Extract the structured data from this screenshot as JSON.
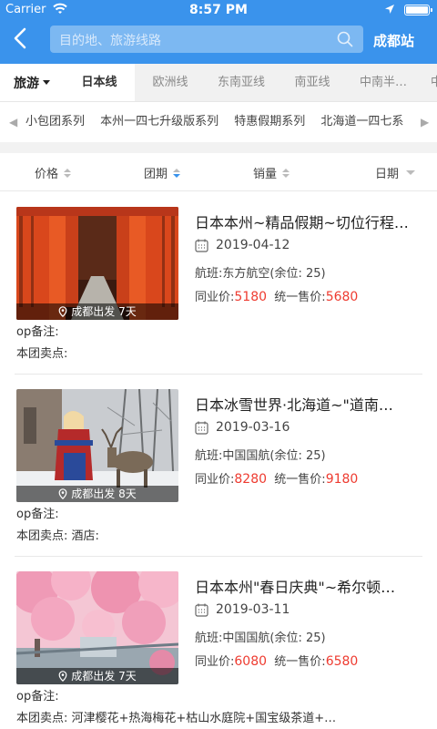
{
  "status_bar": {
    "carrier": "Carrier",
    "time": "8:57 PM"
  },
  "nav": {
    "search_placeholder": "目的地、旅游线路",
    "station": "成都站"
  },
  "tabs": {
    "first": "旅游",
    "items": [
      "日本线",
      "欧洲线",
      "东南亚线",
      "南亚线",
      "中南半…",
      "中东非线"
    ]
  },
  "series": [
    "小包团系列",
    "本州一四七升级版系列",
    "特惠假期系列",
    "北海道一四七系"
  ],
  "sort": {
    "price": "价格",
    "group": "团期",
    "sales": "销量",
    "date": "日期"
  },
  "tours": [
    {
      "title": "日本本州~精品假期~切位行程…",
      "date": "2019-04-12",
      "flight": "航班:东方航空(余位: 25)",
      "peer_label": "同业价:",
      "peer_price": "5180",
      "retail_label": "统一售价:",
      "retail_price": "5680",
      "badge": "成都出发 7天",
      "op_note": "op备注:",
      "selling": "本团卖点:"
    },
    {
      "title": "日本冰雪世界·北海道~\"道南…",
      "date": "2019-03-16",
      "flight": "航班:中国国航(余位: 25)",
      "peer_label": "同业价:",
      "peer_price": "8280",
      "retail_label": "统一售价:",
      "retail_price": "9180",
      "badge": "成都出发 8天",
      "op_note": "op备注:",
      "selling": "本团卖点:   酒店:"
    },
    {
      "title": "日本本州\"春日庆典\"~希尔顿…",
      "date": "2019-03-11",
      "flight": "航班:中国国航(余位: 25)",
      "peer_label": "同业价:",
      "peer_price": "6080",
      "retail_label": "统一售价:",
      "retail_price": "6580",
      "badge": "成都出发 7天",
      "op_note": "op备注:",
      "selling": "本团卖点:  河津樱花+热海梅花+枯山水庭院+国宝级茶道+…"
    }
  ],
  "colors": {
    "brand": "#3a93ec",
    "price": "#ee3b30"
  }
}
